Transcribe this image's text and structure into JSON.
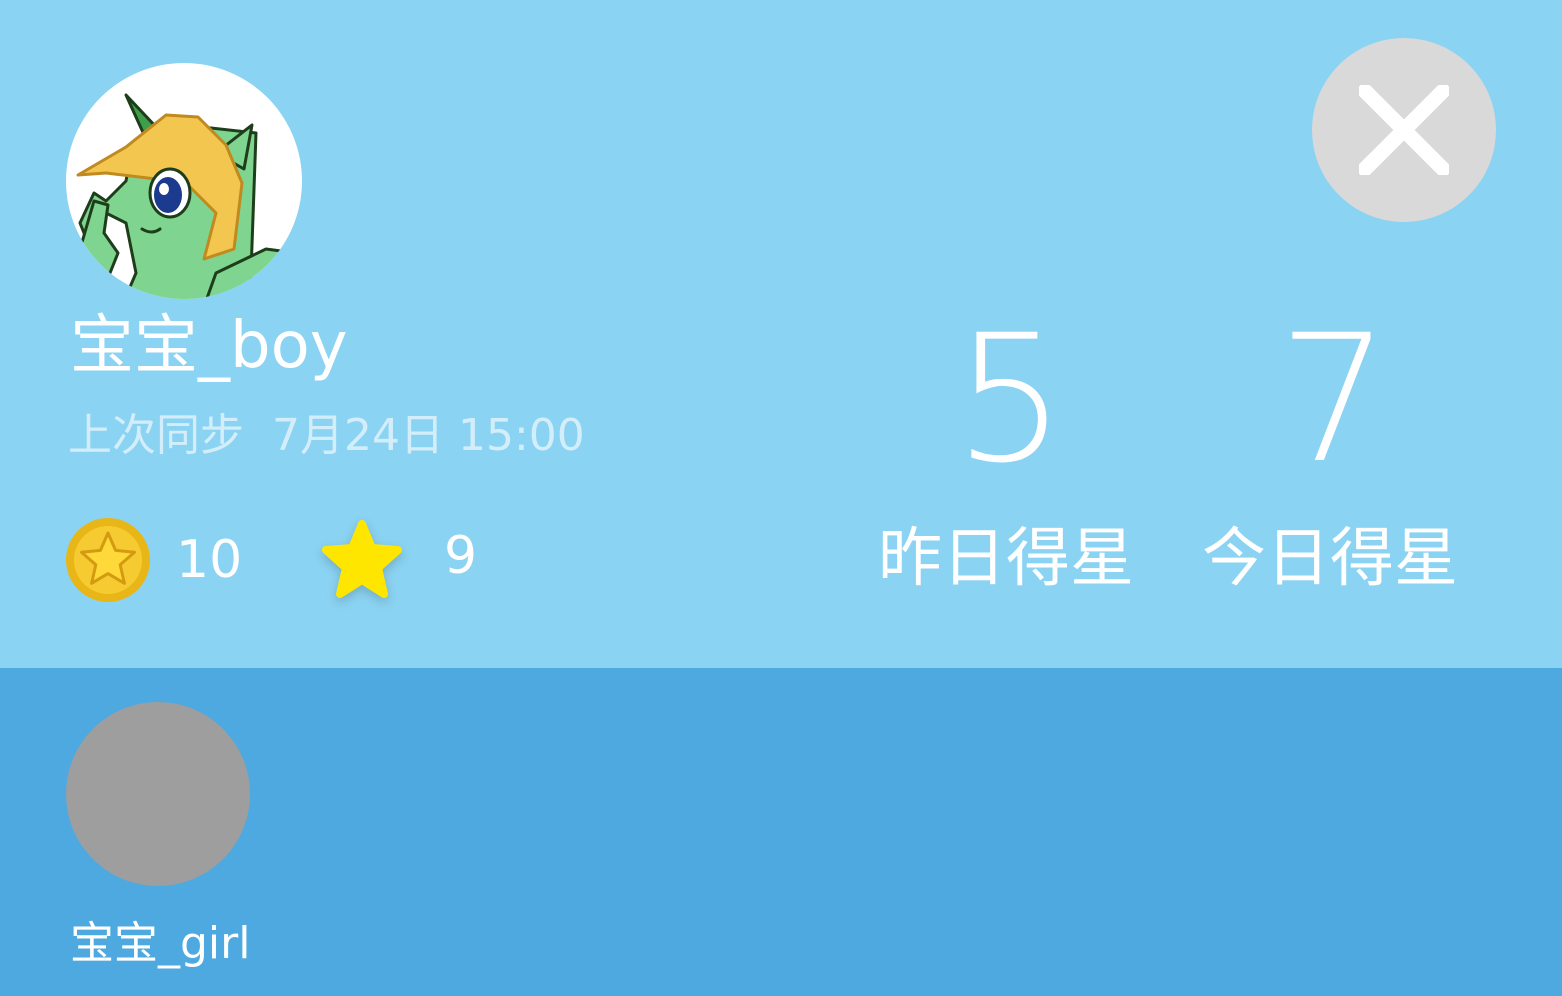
{
  "current_user": {
    "name": "宝宝_boy",
    "avatar_icon": "pony-avatar-icon",
    "sync_label": "上次同步",
    "sync_time": "7月24日 15:00",
    "coins": "10",
    "stars": "9"
  },
  "stats": {
    "yesterday_value": "5",
    "yesterday_label": "昨日得星",
    "today_value": "7",
    "today_label": "今日得星"
  },
  "other_users": [
    {
      "name": "宝宝_girl"
    }
  ],
  "icons": {
    "close": "close-icon",
    "coin": "coin-icon",
    "star": "star-icon"
  },
  "colors": {
    "top_background": "#8bd3f2",
    "bottom_background": "#4ea9e0",
    "close_button": "#d9d9d9",
    "placeholder_avatar": "#9e9e9e",
    "coin": "#f0c419",
    "star": "#ffe600"
  }
}
